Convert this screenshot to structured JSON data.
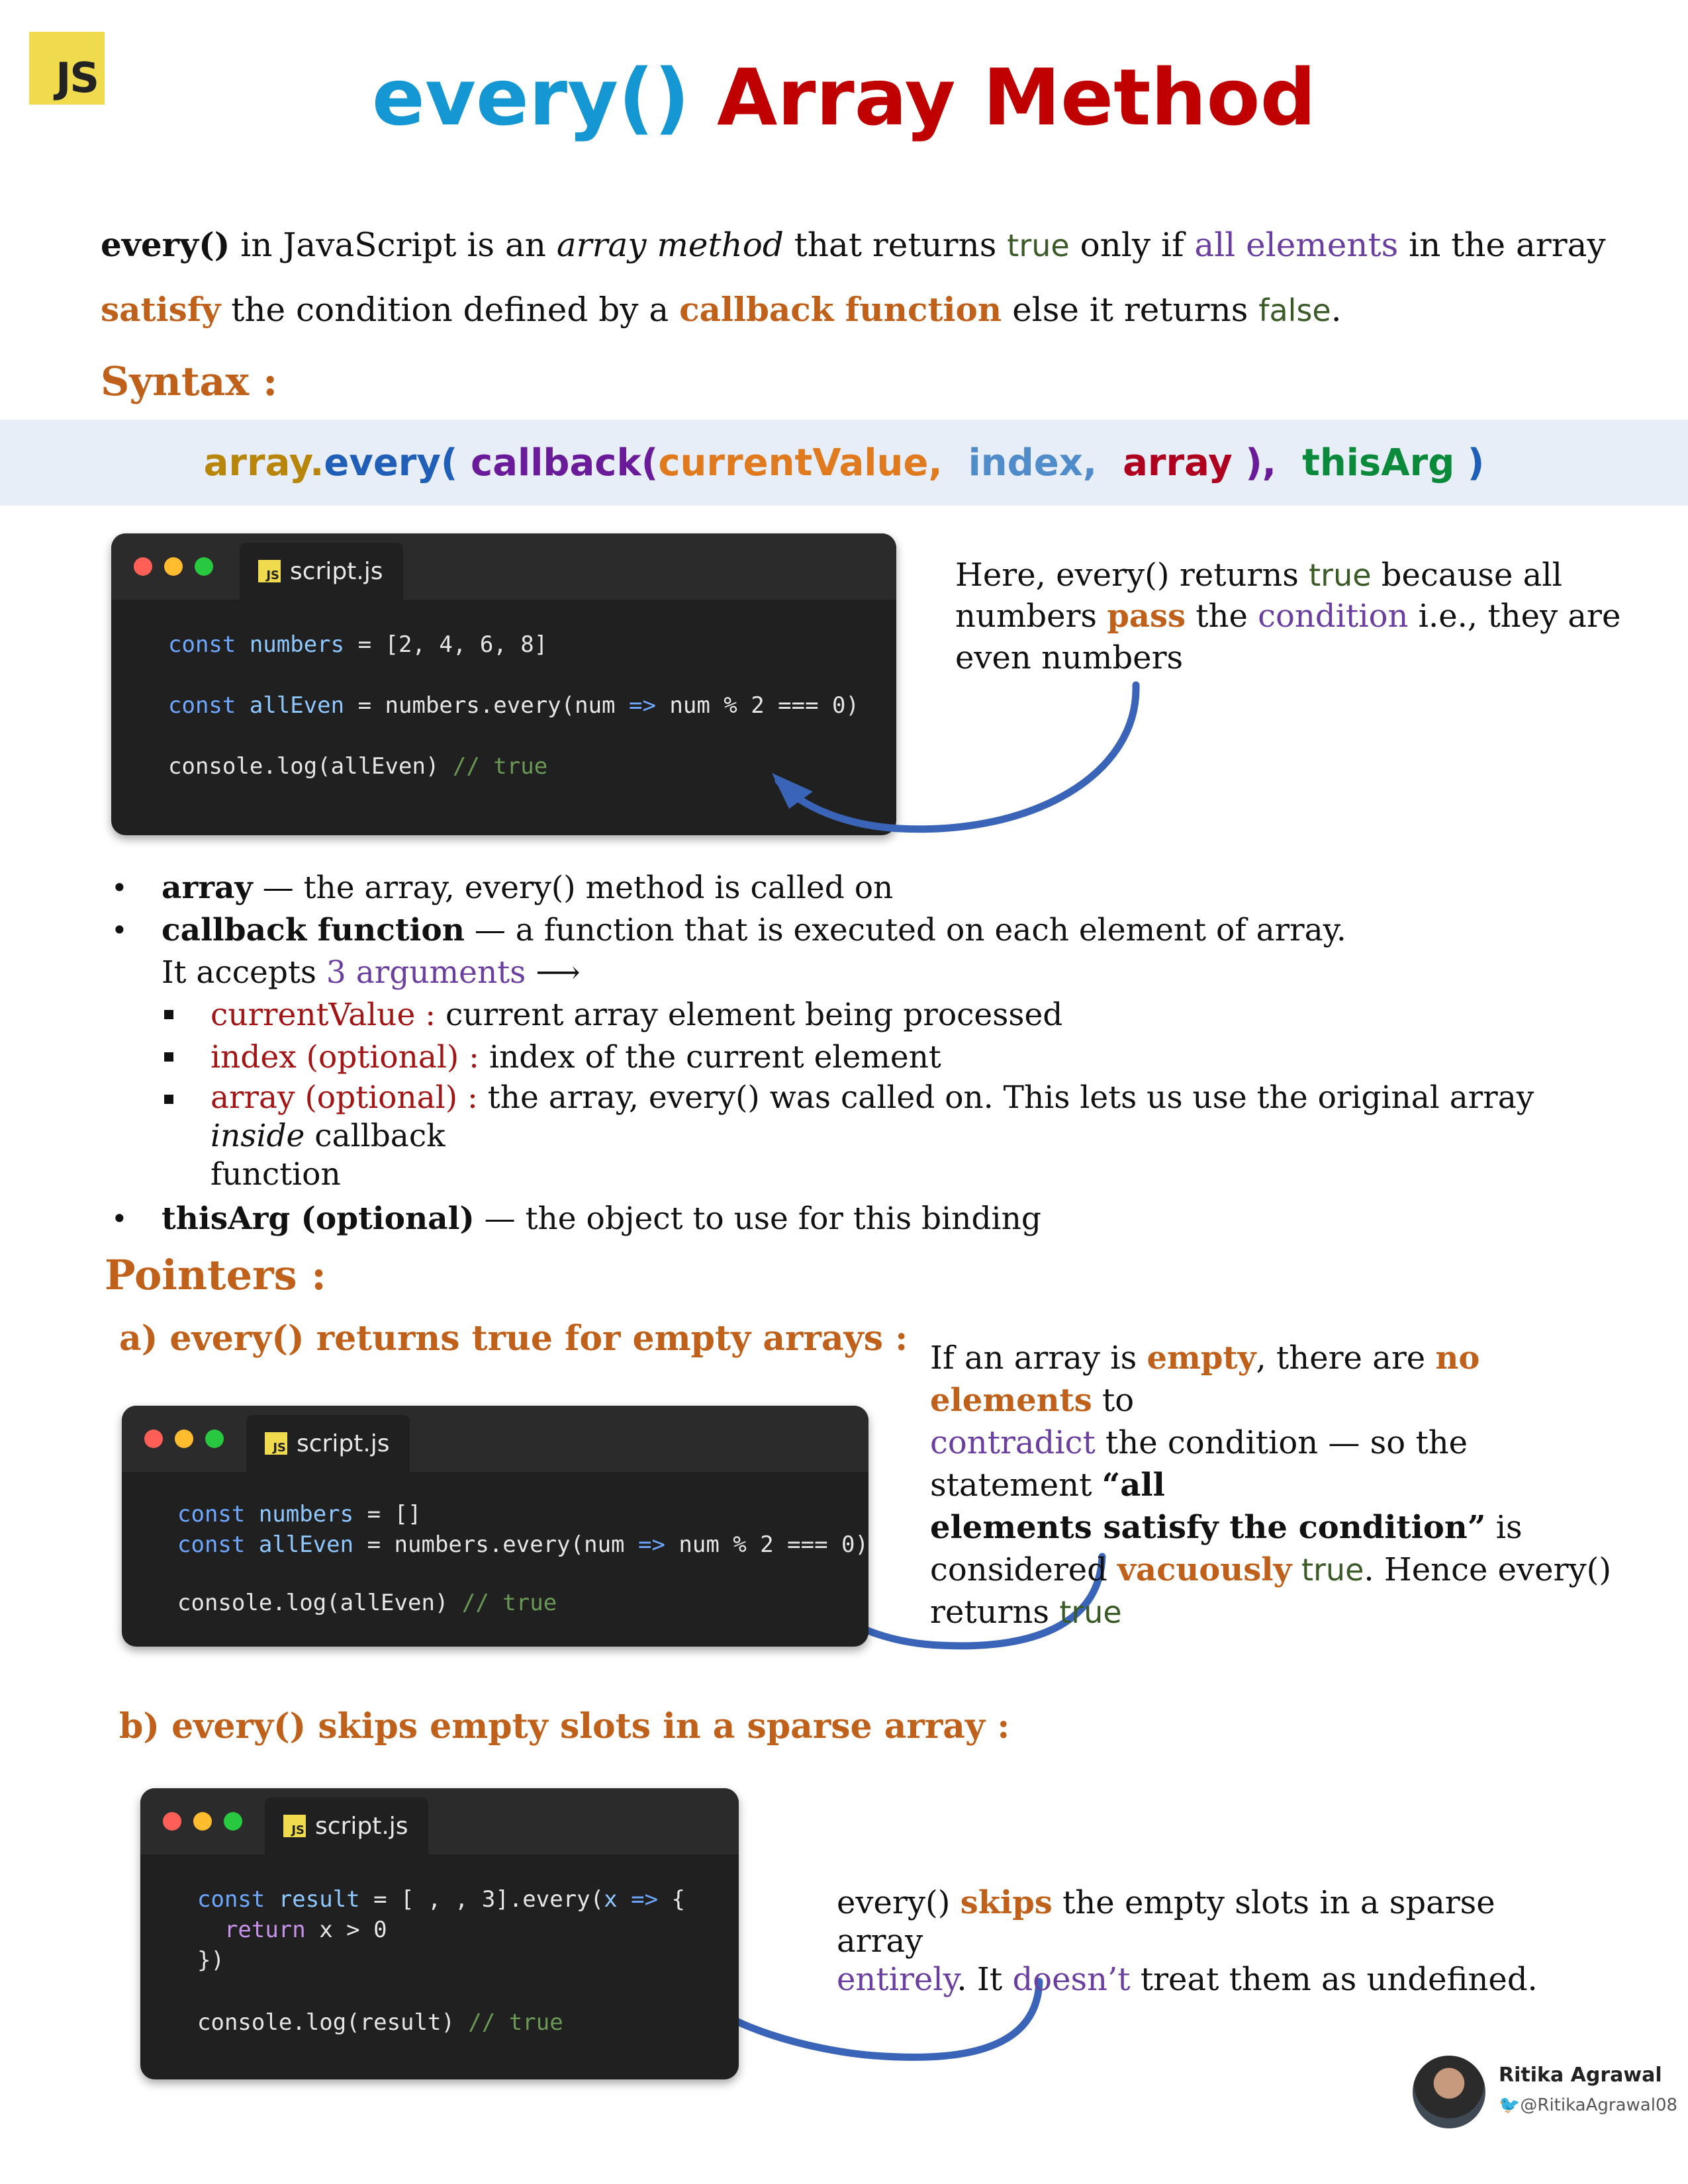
{
  "badge": {
    "text": "JS"
  },
  "title": {
    "part1": "every()",
    "part2": "Array Method"
  },
  "intro": {
    "l1_a": "every()",
    "l1_b": " in JavaScript is an ",
    "l1_c": "array method",
    "l1_d": " that returns ",
    "l1_e": "true",
    "l1_f": " only if ",
    "l1_g": "all elements",
    "l1_h": " in the array",
    "l2_a": "satisfy",
    "l2_b": " the condition defined by a ",
    "l2_c": "callback function",
    "l2_d": " else it returns ",
    "l2_e": "false",
    "l2_f": "."
  },
  "syntax": {
    "heading": "Syntax :",
    "p1": "array.",
    "p2": "every(",
    "p3": " callback(",
    "p4": "currentValue,",
    "p5": "  index,",
    "p6": "  array",
    "p7": " ),",
    "p8": "  thisArg",
    "p9": " )"
  },
  "code1": {
    "tab": "script.js",
    "js_icon": "JS",
    "l1": [
      "const",
      " numbers",
      " = [2, 4, 6, 8]"
    ],
    "l2": [
      "const",
      " allEven",
      " = numbers.every(num ",
      "=>",
      " num % 2 === 0)"
    ],
    "l3": [
      "console.log(allEven) ",
      "// true"
    ]
  },
  "note1": {
    "a": "Here, every() returns ",
    "b": "true",
    "c": " because all",
    "d": "numbers ",
    "e": "pass",
    "f": " the ",
    "g": "condition",
    "h": " i.e., they are",
    "i": "even numbers"
  },
  "bullets": {
    "b1_bold": "array",
    "b1_rest": " — the array, every() method is called on",
    "b2_bold": "callback function",
    "b2_rest": " — a function that is executed on each element of array.",
    "b2_line2a": "It accepts ",
    "b2_line2b": "3 arguments",
    "b2_line2c": " ⟶",
    "s1_label": "currentValue :",
    "s1_rest": " current array element being processed",
    "s2_label": "index (optional) :",
    "s2_rest": " index of the current element",
    "s3_label": "array (optional) :",
    "s3_rest_a": " the array, every() was called on. This lets us use the original array ",
    "s3_rest_b": "inside",
    "s3_rest_c": " callback",
    "s3_rest_d": "function",
    "b3_bold": "thisArg (optional)",
    "b3_rest": " — the object to use for this binding",
    "bullet_char": "•"
  },
  "pointers": {
    "heading": "Pointers :",
    "a_title": "a)  every() returns true for empty arrays :",
    "b_title": "b)  every() skips empty slots in a sparse array :"
  },
  "code2": {
    "tab": "script.js",
    "js_icon": "JS",
    "l1": [
      "const",
      " numbers",
      " = []"
    ],
    "l2": [
      "const",
      " allEven",
      " = numbers.every(num ",
      "=>",
      " num % 2 === 0)"
    ],
    "l3": [
      "console.log(allEven) ",
      "// true"
    ]
  },
  "note2": {
    "a": "If an array is ",
    "b": "empty",
    "c": ", there are ",
    "d": "no elements",
    "e": " to",
    "f": "contradict",
    "g": " the condition — so the statement ",
    "h": "“all",
    "i": "elements satisfy the condition”",
    "j": " is",
    "k": "considered ",
    "l": "vacuously",
    "m": " true",
    "n": ". Hence every()",
    "o": "returns ",
    "p": "true"
  },
  "code3": {
    "tab": "script.js",
    "js_icon": "JS",
    "l1": [
      "const",
      " result",
      " = [ , , 3].every(",
      "x",
      " ",
      "=>",
      " {"
    ],
    "l2": [
      "  return",
      " x > 0"
    ],
    "l3": [
      "})"
    ],
    "l4": [
      "console.log(result) ",
      "// true"
    ]
  },
  "note3": {
    "a": "every() ",
    "b": "skips",
    "c": " the empty slots in a sparse array",
    "d": "entirely",
    "e": ". It ",
    "f": "doesn’t",
    "g": " treat them as undefined."
  },
  "author": {
    "name": "Ritika Agrawal",
    "handle": "@RitikaAgrawal08",
    "twitter_icon": "twitter-bird"
  },
  "colors": {
    "accent_orange": "#c0611b",
    "title_blue": "#1497d3",
    "title_red": "#c00000",
    "arrow_blue": "#3a64b8",
    "js_yellow": "#f0db4f"
  }
}
